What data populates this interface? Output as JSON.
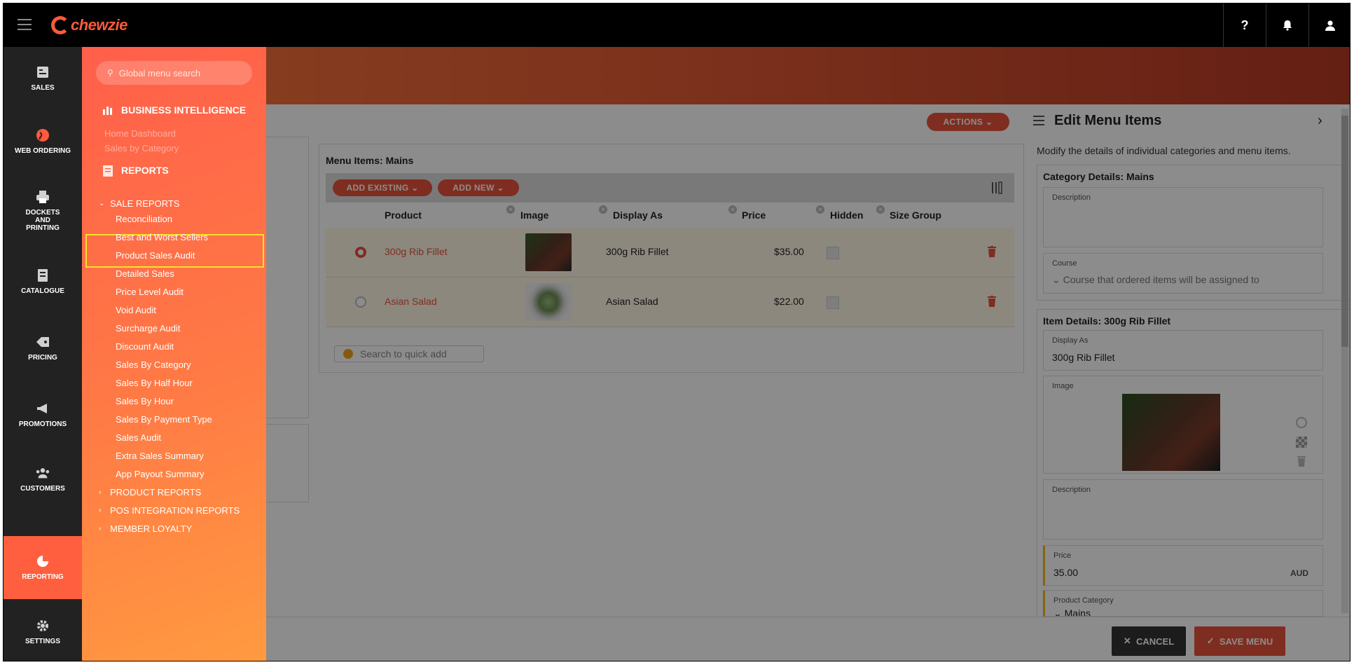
{
  "brand": {
    "name": "chewzie"
  },
  "topbar": {
    "help": "?",
    "icons": [
      "help-icon",
      "bell-icon",
      "user-icon"
    ]
  },
  "rail": [
    {
      "label": "SALES",
      "icon": "sales-icon"
    },
    {
      "label": "WEB ORDERING",
      "icon": "globe-icon"
    },
    {
      "label": "DOCKETS AND PRINTING",
      "icon": "printer-icon"
    },
    {
      "label": "CATALOGUE",
      "icon": "catalogue-icon"
    },
    {
      "label": "PRICING",
      "icon": "tag-icon"
    },
    {
      "label": "PROMOTIONS",
      "icon": "megaphone-icon"
    },
    {
      "label": "CUSTOMERS",
      "icon": "users-icon"
    },
    {
      "label": "REPORTING",
      "icon": "pie-chart-icon",
      "active": true
    },
    {
      "label": "SETTINGS",
      "icon": "gear-icon"
    }
  ],
  "flyout": {
    "search_placeholder": "Global menu search",
    "bi_heading": "BUSINESS INTELLIGENCE",
    "bi_links": [
      "Home Dashboard",
      "Sales by Category"
    ],
    "reports_heading": "REPORTS",
    "sale_reports": "SALE REPORTS",
    "sale_items": [
      "Reconciliation",
      "Best and Worst Sellers",
      "Product Sales Audit",
      "Detailed Sales",
      "Price Level Audit",
      "Void Audit",
      "Surcharge Audit",
      "Discount Audit",
      "Sales By Category",
      "Sales By Half Hour",
      "Sales By Hour",
      "Sales By Payment Type",
      "Sales Audit",
      "Extra Sales Summary",
      "App Payout Summary"
    ],
    "collapsed_groups": [
      "PRODUCT REPORTS",
      "POS INTEGRATION REPORTS",
      "MEMBER LOYALTY"
    ]
  },
  "actions_label": "ACTIONS",
  "menu_items": {
    "title": "Menu Items: Mains",
    "add_existing": "ADD EXISTING",
    "add_new": "ADD NEW",
    "columns": [
      "Product",
      "Image",
      "Display As",
      "Price",
      "Hidden",
      "Size Group"
    ],
    "rows": [
      {
        "product": "300g Rib Fillet",
        "display_as": "300g Rib Fillet",
        "price": "$35.00",
        "selected": true
      },
      {
        "product": "Asian Salad",
        "display_as": "Asian Salad",
        "price": "$22.00",
        "selected": false
      }
    ],
    "quick_add_placeholder": "Search to quick add"
  },
  "edit_panel": {
    "title": "Edit Menu Items",
    "description": "Modify the details of individual categories and menu items.",
    "category_title": "Category Details: Mains",
    "description_label": "Description",
    "course_label": "Course",
    "course_placeholder": "Course that ordered items will be assigned to",
    "item_title": "Item Details: 300g Rib Fillet",
    "display_as_label": "Display As",
    "display_as_value": "300g Rib Fillet",
    "image_label": "Image",
    "item_description_label": "Description",
    "price_label": "Price",
    "price_value": "35.00",
    "currency": "AUD",
    "product_category_label": "Product Category",
    "product_category_value": "Mains"
  },
  "footer": {
    "cancel": "CANCEL",
    "save": "SAVE MENU"
  },
  "colors": {
    "accent": "#e8533b",
    "highlight": "#f6e12a"
  }
}
